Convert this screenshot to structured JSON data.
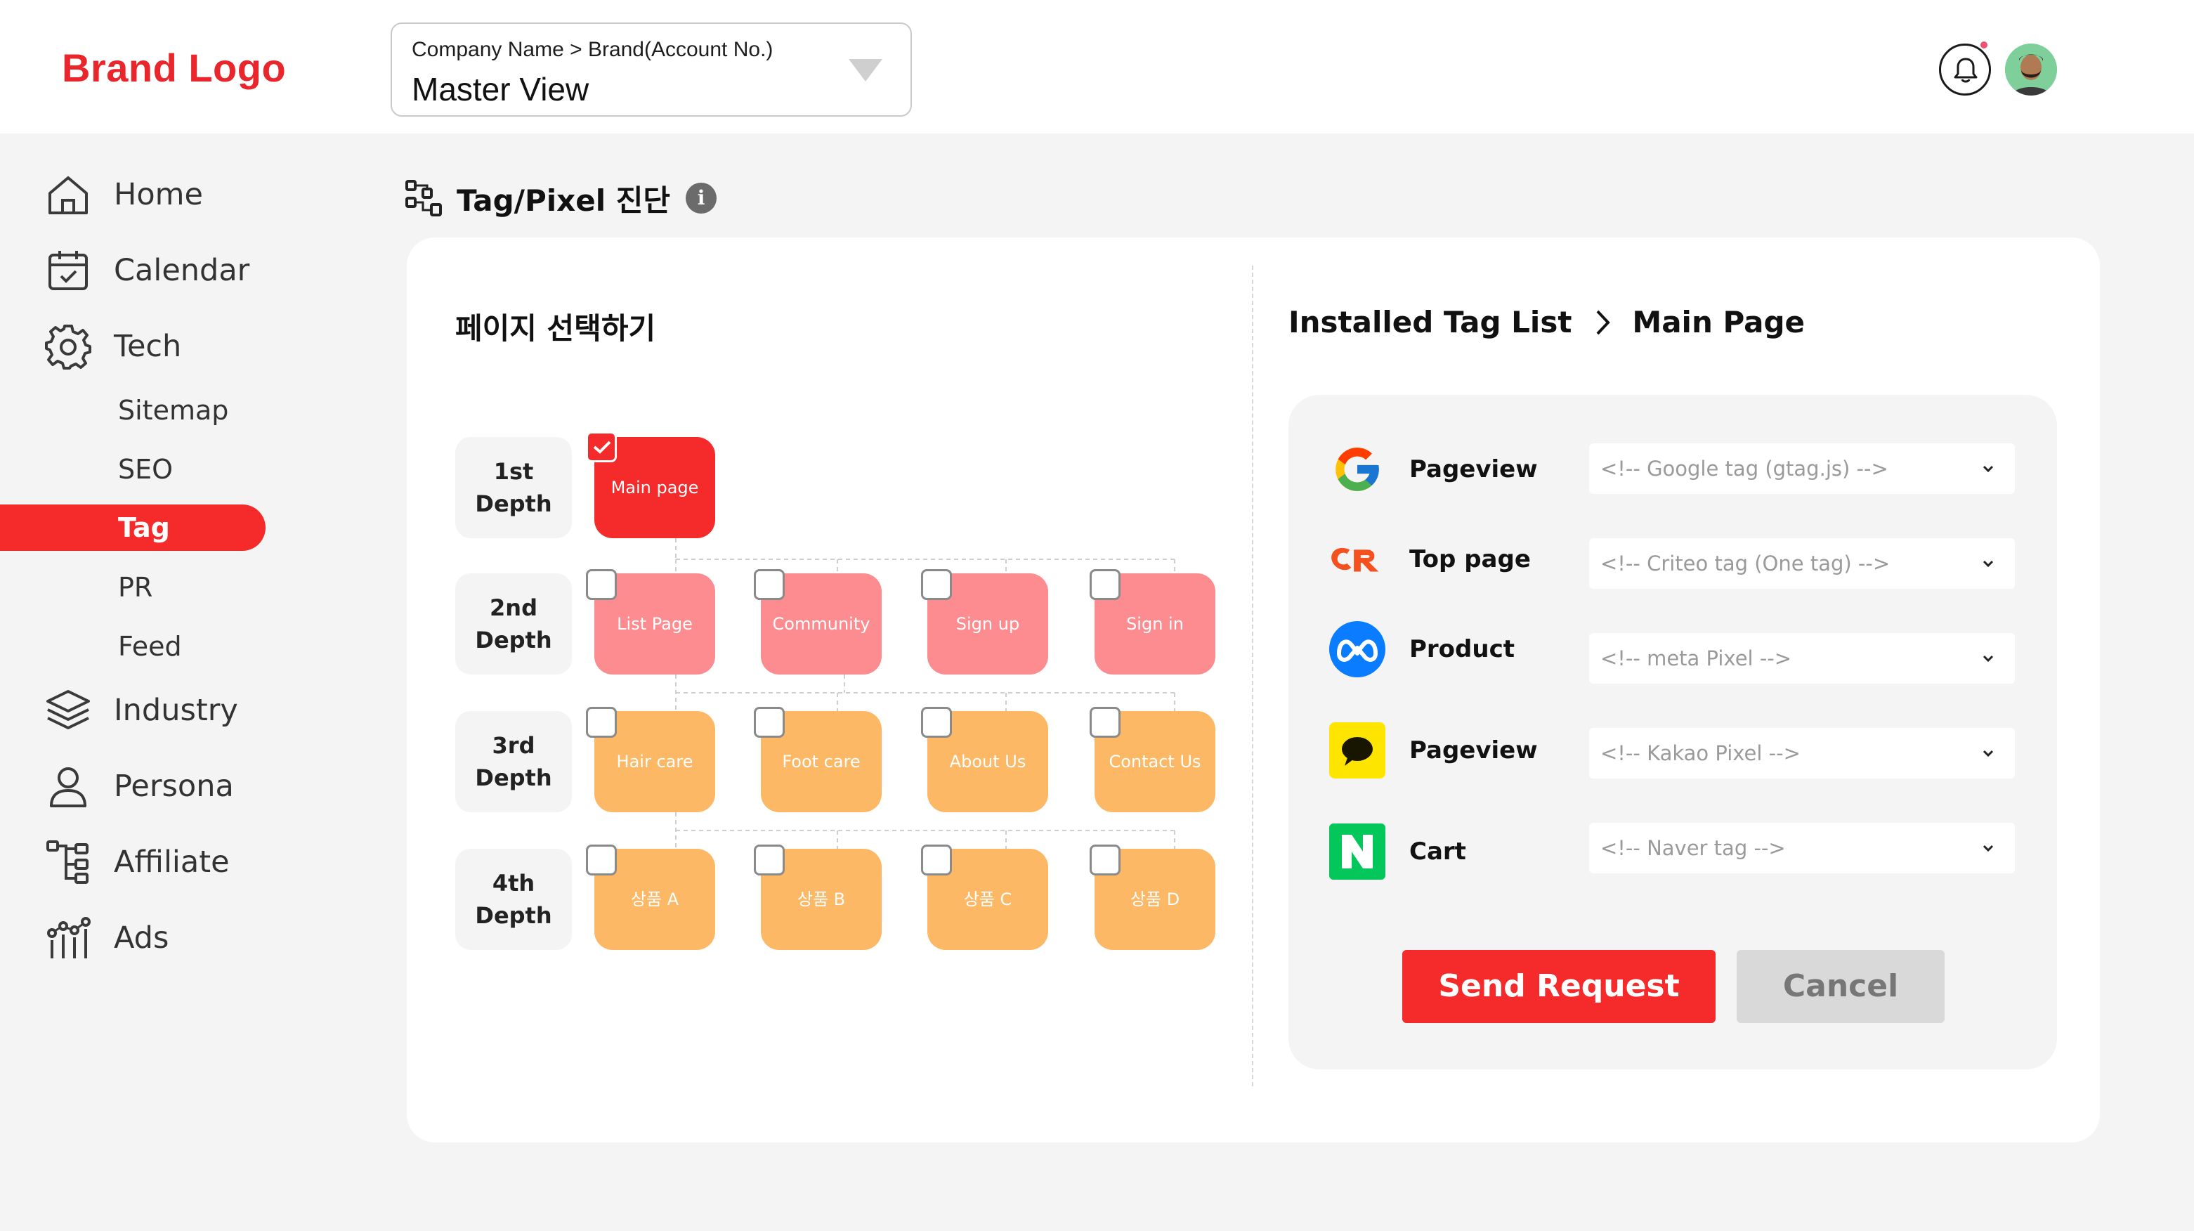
{
  "header": {
    "brand_logo": "Brand Logo",
    "account_path": "Company Name > Brand(Account No.)",
    "account_view": "Master View",
    "notification_dot_color": "#f0506e"
  },
  "sidebar": {
    "items": [
      {
        "label": "Home",
        "icon": "home-icon"
      },
      {
        "label": "Calendar",
        "icon": "calendar-icon"
      },
      {
        "label": "Tech",
        "icon": "gear-icon"
      },
      {
        "label": "Industry",
        "icon": "layers-icon"
      },
      {
        "label": "Persona",
        "icon": "person-icon"
      },
      {
        "label": "Affiliate",
        "icon": "hierarchy-icon"
      },
      {
        "label": "Ads",
        "icon": "ads-chart-icon"
      }
    ],
    "tech_sub_items": [
      "Sitemap",
      "SEO",
      "Tag",
      "PR",
      "Feed"
    ],
    "active_sub_item": "Tag",
    "accent_color": "#f52a2a"
  },
  "page": {
    "title": "Tag/Pixel 진단",
    "info": "i"
  },
  "selector": {
    "title": "페이지 선택하기",
    "depths": [
      {
        "line1": "1st",
        "line2": "Depth"
      },
      {
        "line1": "2nd",
        "line2": "Depth"
      },
      {
        "line1": "3rd",
        "line2": "Depth"
      },
      {
        "line1": "4th",
        "line2": "Depth"
      }
    ],
    "depth1": [
      {
        "label": "Main page",
        "checked": true
      }
    ],
    "depth2": [
      {
        "label": "List Page",
        "checked": false
      },
      {
        "label": "Community",
        "checked": false
      },
      {
        "label": "Sign up",
        "checked": false
      },
      {
        "label": "Sign in",
        "checked": false
      }
    ],
    "depth3": [
      {
        "label": "Hair care",
        "checked": false
      },
      {
        "label": "Foot care",
        "checked": false
      },
      {
        "label": "About Us",
        "checked": false
      },
      {
        "label": "Contact Us",
        "checked": false
      }
    ],
    "depth4": [
      {
        "label": "상품 A",
        "checked": false
      },
      {
        "label": "상품 B",
        "checked": false
      },
      {
        "label": "상품 C",
        "checked": false
      },
      {
        "label": "상품 D",
        "checked": false
      }
    ],
    "colors": {
      "depth1": "#f52a2a",
      "depth2": "#fc8c8f",
      "depth3": "#fdb866",
      "depth4": "#fdb866"
    }
  },
  "tags": {
    "title": "Installed Tag List",
    "subtitle": "Main Page",
    "rows": [
      {
        "icon": "google-icon",
        "label": "Pageview",
        "select": "<!-- Google tag (gtag.js) -->"
      },
      {
        "icon": "criteo-icon",
        "label": "Top page",
        "select": "<!-- Criteo tag (One tag) -->"
      },
      {
        "icon": "meta-icon",
        "label": "Product",
        "select": "<!-- meta Pixel -->"
      },
      {
        "icon": "kakao-icon",
        "label": "Pageview",
        "select": "<!-- Kakao Pixel -->"
      },
      {
        "icon": "naver-icon",
        "label": "Cart",
        "select": "<!-- Naver tag -->"
      }
    ],
    "send_label": "Send Request",
    "cancel_label": "Cancel"
  }
}
